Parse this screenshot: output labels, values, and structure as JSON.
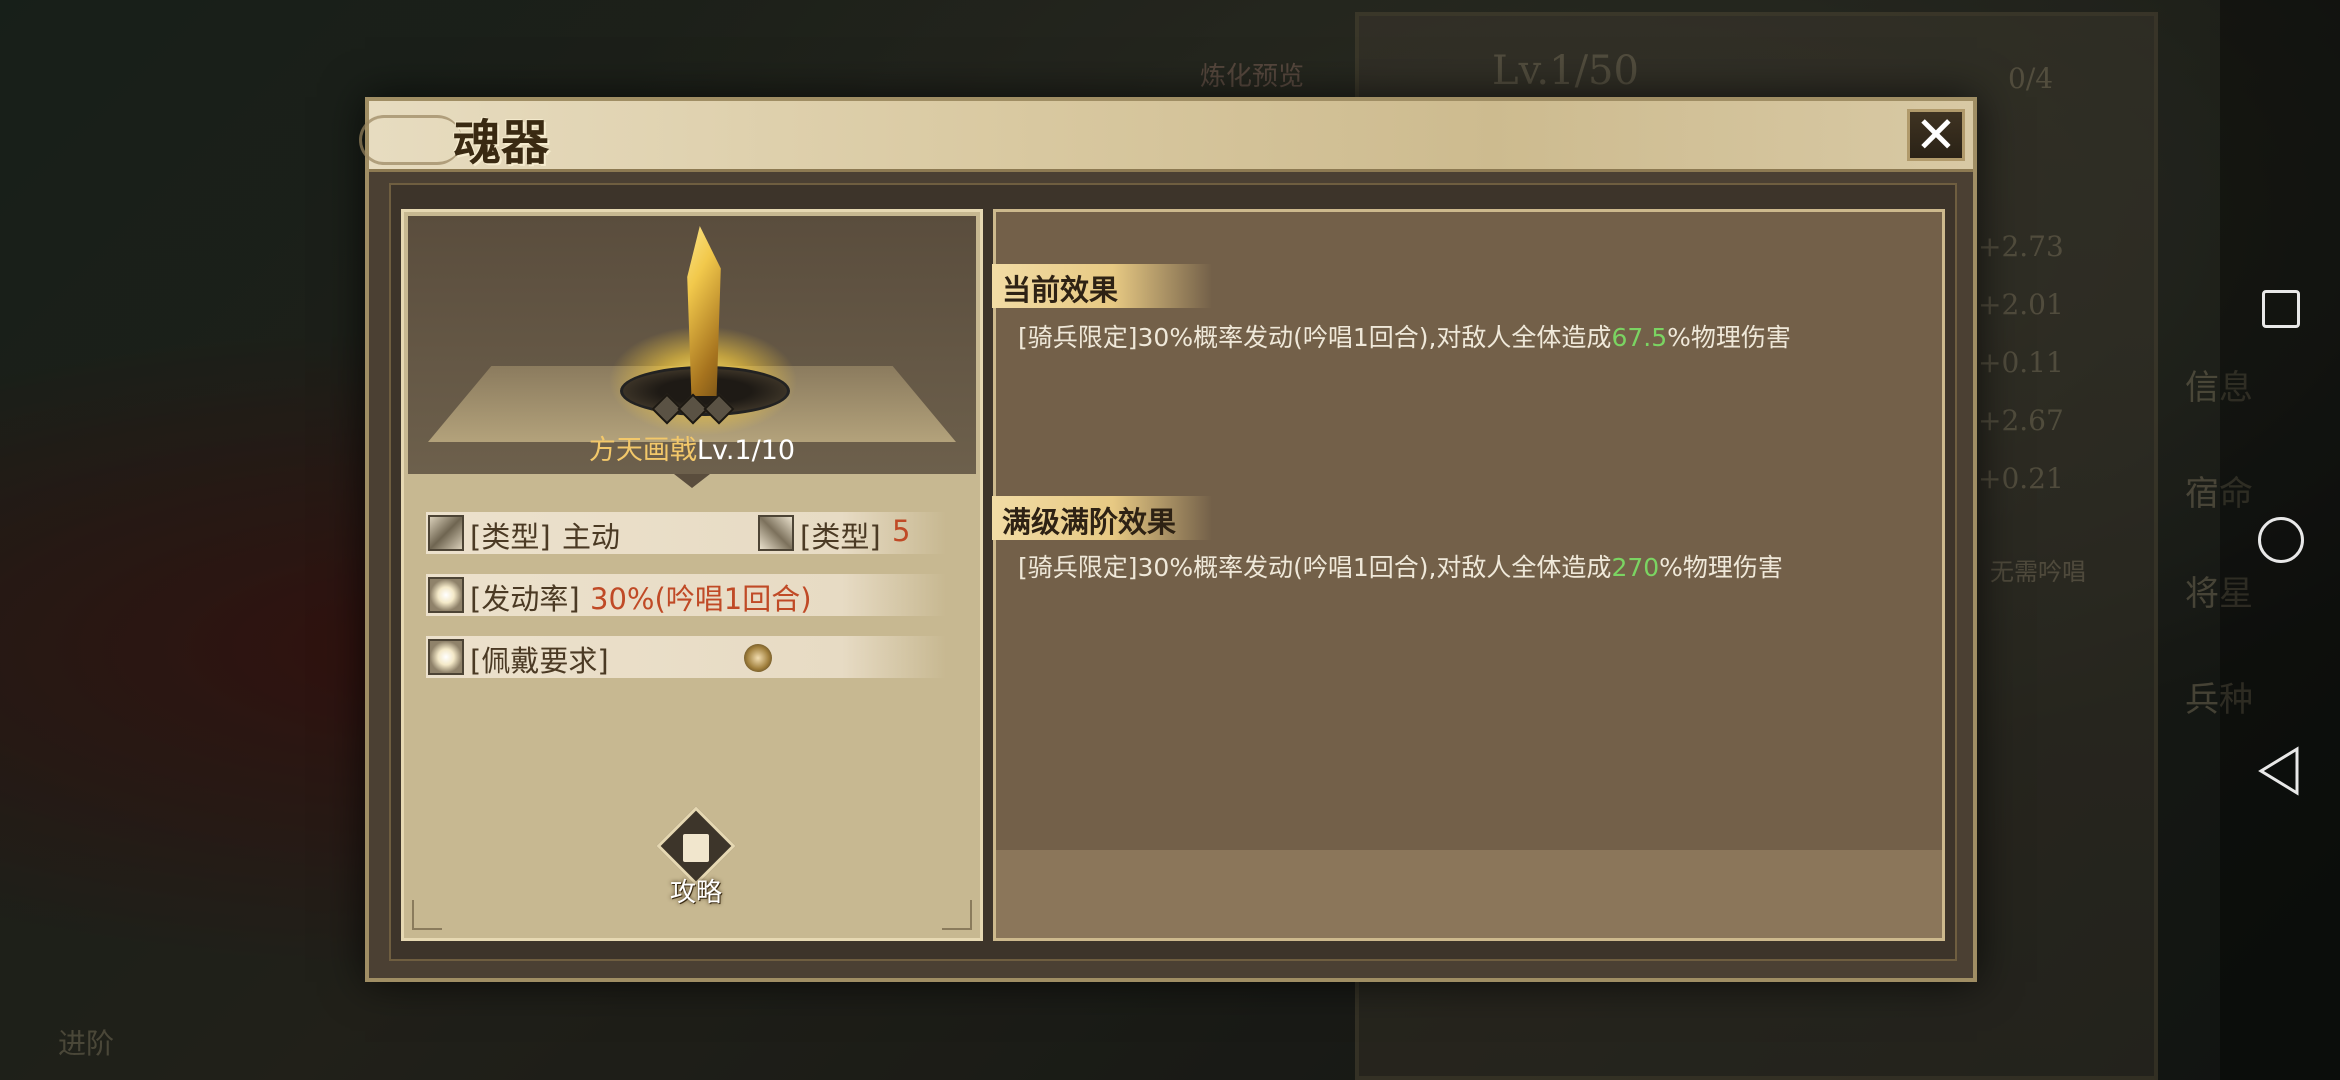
{
  "background": {
    "level_text": "Lv.1/50",
    "progress_text": "0/4",
    "refine_preview": "炼化预览",
    "stats": [
      "+2.73",
      "+2.01",
      "+0.11",
      "+2.67",
      "+0.21"
    ],
    "no_chant": "无需吟唱",
    "side_tabs": [
      "信息",
      "宿命",
      "将星",
      "兵种"
    ],
    "advance_label": "进阶"
  },
  "dialog": {
    "title": "魂器",
    "close_icon": "close-icon",
    "item": {
      "name": "方天画戟",
      "level": "Lv.1/10"
    },
    "stats": {
      "type_label": "[类型]",
      "type_value": "主动",
      "type2_label": "[类型]",
      "type2_value": "5",
      "rate_label": "[发动率]",
      "rate_value": "30%(吟唱1回合)",
      "req_label": "[佩戴要求]",
      "req_icon": "horse-icon"
    },
    "guide_label": "攻略",
    "current_effect": {
      "header": "当前效果",
      "text_before": "[骑兵限定]30%概率发动(吟唱1回合),对敌人全体造成",
      "value": "67.5",
      "text_after": "%物理伤害"
    },
    "max_effect": {
      "header": "满级满阶效果",
      "text_before": "[骑兵限定]30%概率发动(吟唱1回合),对敌人全体造成",
      "value": "270",
      "text_after": "%物理伤害"
    },
    "colors": {
      "highlight_green": "#7bd462",
      "stat_value": "#c04a26",
      "item_name": "#f3c86a"
    }
  }
}
